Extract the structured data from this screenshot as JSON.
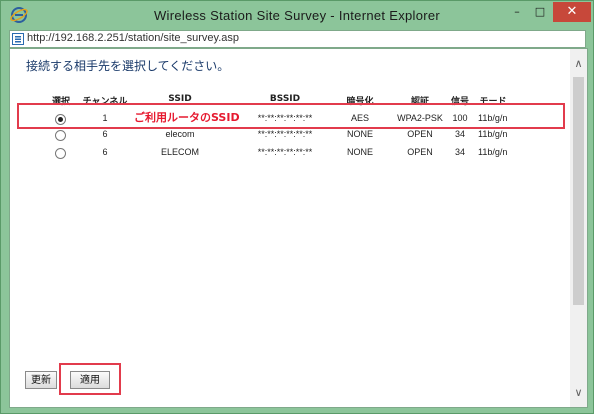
{
  "window": {
    "title": "Wireless Station Site Survey - Internet Explorer",
    "controls": {
      "minimize": "–",
      "maximize": "□",
      "close": "✕"
    }
  },
  "address": {
    "url": "http://192.168.2.251/station/site_survey.asp"
  },
  "page": {
    "heading": "接続する相手先を選択してください。",
    "columns": [
      "選択",
      "チャンネル",
      "SSID",
      "BSSID",
      "暗号化",
      "認証",
      "信号",
      "モード"
    ],
    "rows": [
      {
        "selected": true,
        "channel": "1",
        "ssid": "",
        "bssid": "**:**:**:**:**:**",
        "encryption": "AES",
        "auth": "WPA2-PSK",
        "signal": "100",
        "mode": "11b/g/n"
      },
      {
        "selected": false,
        "channel": "6",
        "ssid": "elecom",
        "bssid": "**:**:**:**:**:**",
        "encryption": "NONE",
        "auth": "OPEN",
        "signal": "34",
        "mode": "11b/g/n"
      },
      {
        "selected": false,
        "channel": "6",
        "ssid": "ELECOM",
        "bssid": "**:**:**:**:**:**",
        "encryption": "NONE",
        "auth": "OPEN",
        "signal": "34",
        "mode": "11b/g/n"
      }
    ],
    "annotation": "ご利用ルータのSSID",
    "buttons": {
      "refresh": "更新",
      "apply": "適用"
    }
  },
  "colors": {
    "titlebar": "#8cc59a",
    "highlight": "#e23b4c",
    "annotation": "#e6192f"
  }
}
